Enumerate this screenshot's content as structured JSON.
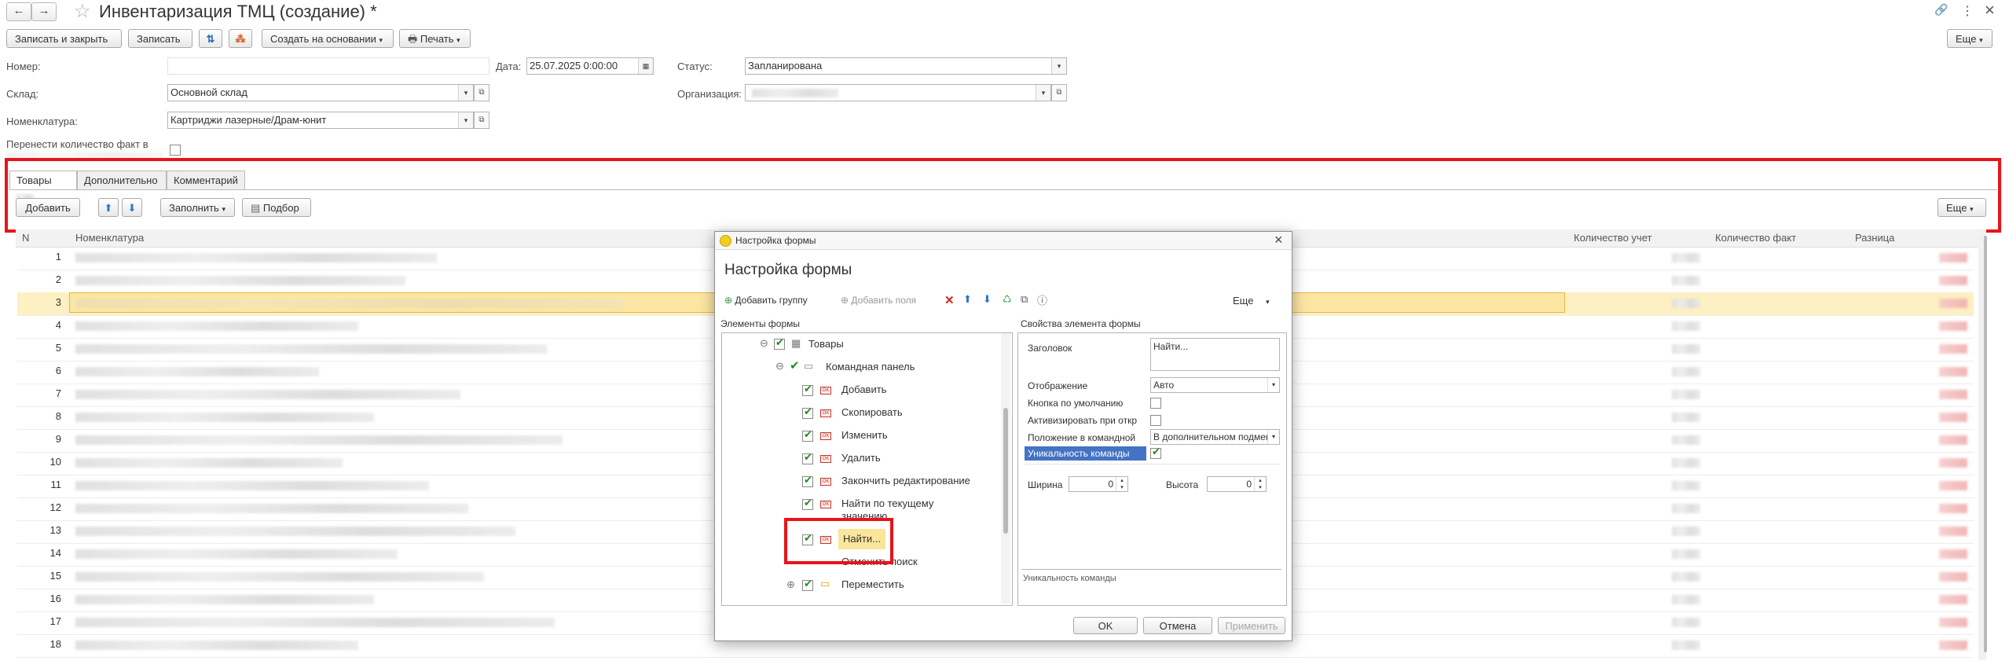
{
  "window": {
    "title": "Инвентаризация ТМЦ (создание) *",
    "nav_back": "←",
    "nav_forward": "→",
    "star": "☆",
    "link_icon": "🔗",
    "menu_icon": "⋮",
    "close_icon": "×"
  },
  "toolbar": {
    "save_close": "Записать и закрыть",
    "save": "Записать",
    "create_based": "Создать на основании",
    "print": "Печать",
    "more": "Еще"
  },
  "form": {
    "number_label": "Номер:",
    "number_value": "",
    "date_label": "Дата:",
    "date_value": "25.07.2025  0:00:00",
    "status_label": "Статус:",
    "status_value": "Запланирована",
    "warehouse_label": "Склад:",
    "warehouse_value": "Основной склад",
    "org_label": "Организация:",
    "org_value": "",
    "nomenclature_label": "Номенклатура:",
    "nomenclature_value": "Картриджи лазерные/Драм-юнит",
    "transfer_label": "Перенести количество факт в"
  },
  "tabs": [
    {
      "label": "Товары"
    },
    {
      "label": "Дополнительно"
    },
    {
      "label": "Комментарий"
    }
  ],
  "table_toolbar": {
    "add": "Добавить",
    "fill": "Заполнить",
    "select": "Подбор",
    "more": "Еще"
  },
  "table": {
    "columns": [
      "N",
      "Номенклатура",
      "Количество учет",
      "Количество факт",
      "Разница"
    ],
    "rows": [
      "1",
      "2",
      "3",
      "4",
      "5",
      "6",
      "7",
      "8",
      "9",
      "10",
      "11",
      "12",
      "13",
      "14",
      "15",
      "16",
      "17",
      "18"
    ]
  },
  "dialog": {
    "window_title": "Настройка формы",
    "heading": "Настройка формы",
    "add_group": "Добавить группу",
    "add_fields": "Добавить поля",
    "more": "Еще",
    "elements_title": "Элементы формы",
    "props_title": "Свойства элемента формы",
    "tree": {
      "goods": "Товары",
      "command_panel": "Командная панель",
      "add": "Добавить",
      "copy": "Скопировать",
      "edit": "Изменить",
      "delete": "Удалить",
      "finish_edit": "Закончить редактирование",
      "find_current": "Найти по текущему значению",
      "find": "Найти...",
      "cancel_search": "Отменить поиск",
      "move": "Переместить"
    },
    "props": {
      "caption_label": "Заголовок",
      "caption_value": "Найти...",
      "display_label": "Отображение",
      "display_value": "Авто",
      "default_btn_label": "Кнопка по умолчанию",
      "activate_label": "Активизировать при откр",
      "position_label": "Положение в командной",
      "position_value": "В дополнительном подменю",
      "unique_label": "Уникальность команды",
      "width_label": "Ширина",
      "width_value": "0",
      "height_label": "Высота",
      "height_value": "0",
      "hint": "Уникальность команды"
    },
    "ok": "OK",
    "cancel": "Отмена",
    "apply": "Применить"
  }
}
